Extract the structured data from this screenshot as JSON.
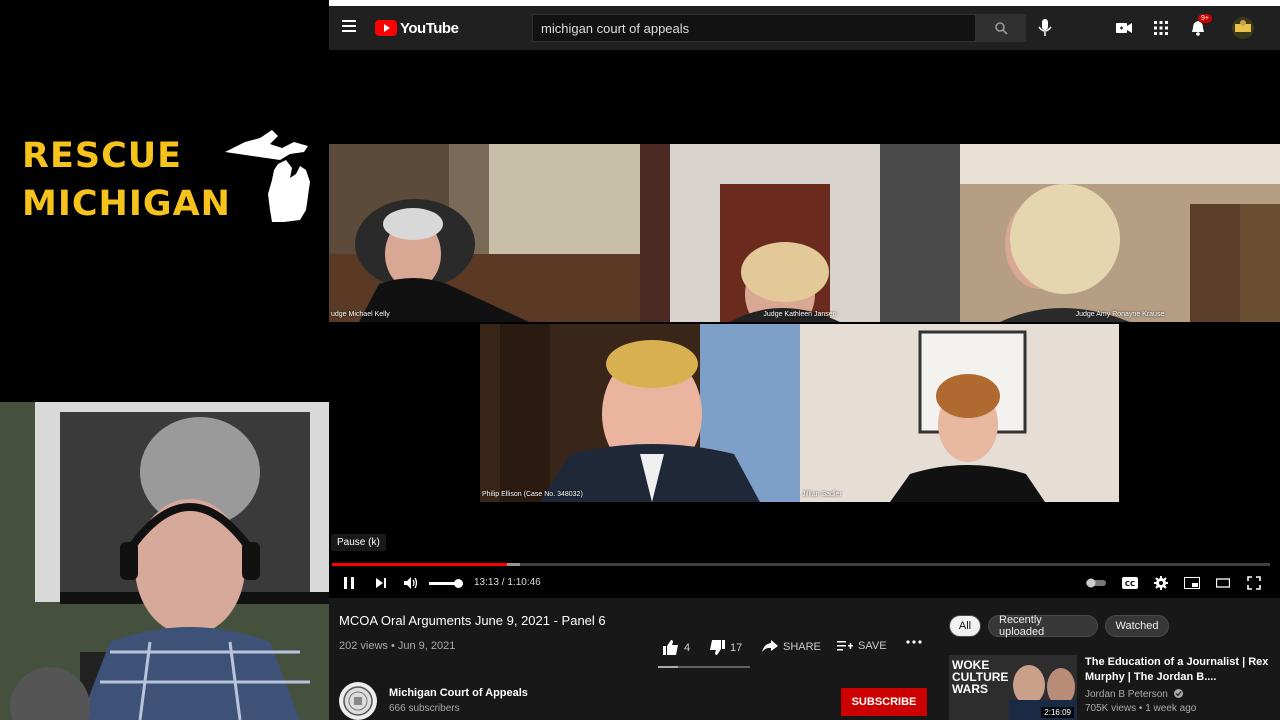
{
  "overlay": {
    "brand_line1": "RESCUE",
    "brand_line2": "MICHIGAN",
    "brand_color": "#f6c21c"
  },
  "header": {
    "logo_text": "YouTube",
    "search_value": "michigan court of appeals",
    "notification_count": "9+",
    "icons": [
      "menu-icon",
      "search-icon",
      "microphone-icon",
      "create-video-icon",
      "apps-grid-icon",
      "bell-icon",
      "avatar"
    ]
  },
  "player": {
    "participants": [
      {
        "label": "udge Michael Kelly"
      },
      {
        "label": "Judge Kathleen Jansen"
      },
      {
        "label": "Judge Amy Ronayne Krause"
      },
      {
        "label": "Philip Ellison (Case No. 348032)"
      },
      {
        "label": "Jillian Sadler"
      }
    ],
    "tooltip": "Pause (k)",
    "time": "13:13 / 1:10:46",
    "progress_played": 0.187,
    "progress_loaded": 0.2,
    "volume": 0.85,
    "accent": "#ff0000"
  },
  "video": {
    "title": "MCOA Oral Arguments June 9, 2021 - Panel 6",
    "meta": "202 views • Jun 9, 2021",
    "likes": "4",
    "dislikes": "17",
    "share_label": "SHARE",
    "save_label": "SAVE",
    "channel_name": "Michigan Court of Appeals",
    "channel_subs": "666 subscribers",
    "subscribe_label": "SUBSCRIBE"
  },
  "sidebar": {
    "chips": [
      {
        "label": "All"
      },
      {
        "label": "Recently uploaded"
      },
      {
        "label": "Watched"
      }
    ],
    "recommendation": {
      "title": "The Education of a Journalist | Rex Murphy | The Jordan B....",
      "channel": "Jordan B Peterson",
      "meta": "705K views • 1 week ago",
      "duration": "2:16:09",
      "thumb_text": "WOKE CULTURE WARS"
    }
  }
}
